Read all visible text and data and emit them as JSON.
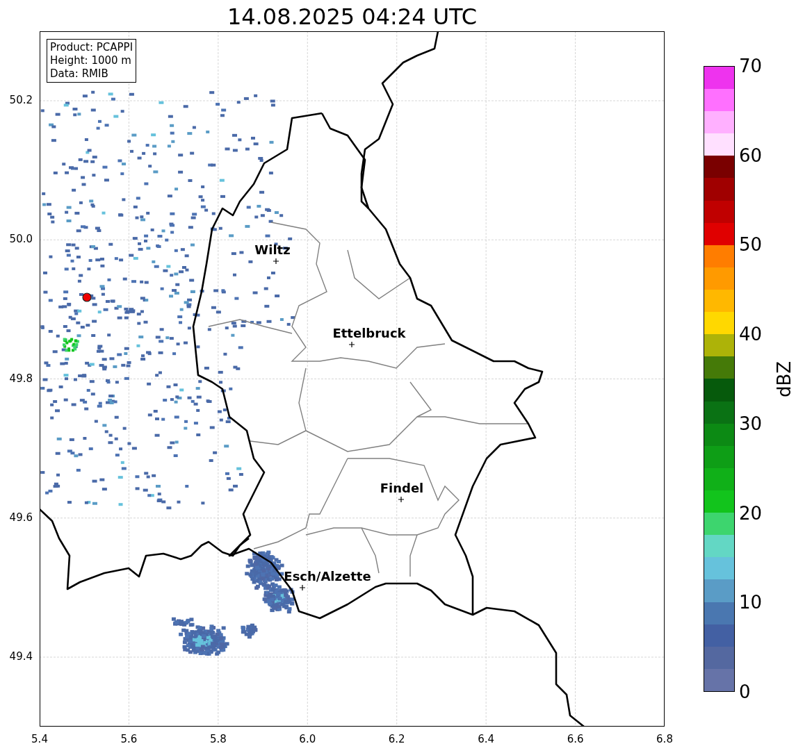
{
  "title": "14.08.2025 04:24 UTC",
  "info_box": [
    "Product: PCAPPI",
    "Height: 1000 m",
    "Data: RMIB"
  ],
  "map": {
    "xticks": [
      "5.4",
      "5.6",
      "5.8",
      "6.0",
      "6.2",
      "6.4",
      "6.6",
      "6.8"
    ],
    "yticks": [
      "50.2",
      "50.0",
      "49.8",
      "49.6",
      "49.4"
    ],
    "cities": [
      {
        "name": "Wiltz"
      },
      {
        "name": "Ettelbruck"
      },
      {
        "name": "Findel"
      },
      {
        "name": "Esch/Alzette"
      }
    ]
  },
  "colorbar": {
    "label": "dBZ",
    "ticks": [
      "70",
      "60",
      "50",
      "40",
      "30",
      "20",
      "10",
      "0"
    ],
    "bins": [
      {
        "color": "#6673a8"
      },
      {
        "color": "#5468a0"
      },
      {
        "color": "#4360a3"
      },
      {
        "color": "#4a77b0"
      },
      {
        "color": "#5a9cc6"
      },
      {
        "color": "#66c2dc"
      },
      {
        "color": "#63d7c4"
      },
      {
        "color": "#3dd56e"
      },
      {
        "color": "#12c41c"
      },
      {
        "color": "#10b018"
      },
      {
        "color": "#0e9e16"
      },
      {
        "color": "#0c8a14"
      },
      {
        "color": "#0a7214"
      },
      {
        "color": "#065a0c"
      },
      {
        "color": "#457a08"
      },
      {
        "color": "#adb308"
      },
      {
        "color": "#ffd800"
      },
      {
        "color": "#ffb800"
      },
      {
        "color": "#ff9a00"
      },
      {
        "color": "#ff7d00"
      },
      {
        "color": "#e00000"
      },
      {
        "color": "#c00000"
      },
      {
        "color": "#a00000"
      },
      {
        "color": "#7a0000"
      },
      {
        "color": "#ffe0ff"
      },
      {
        "color": "#ffb0ff"
      },
      {
        "color": "#ff70ff"
      },
      {
        "color": "#ee33ee"
      }
    ]
  }
}
